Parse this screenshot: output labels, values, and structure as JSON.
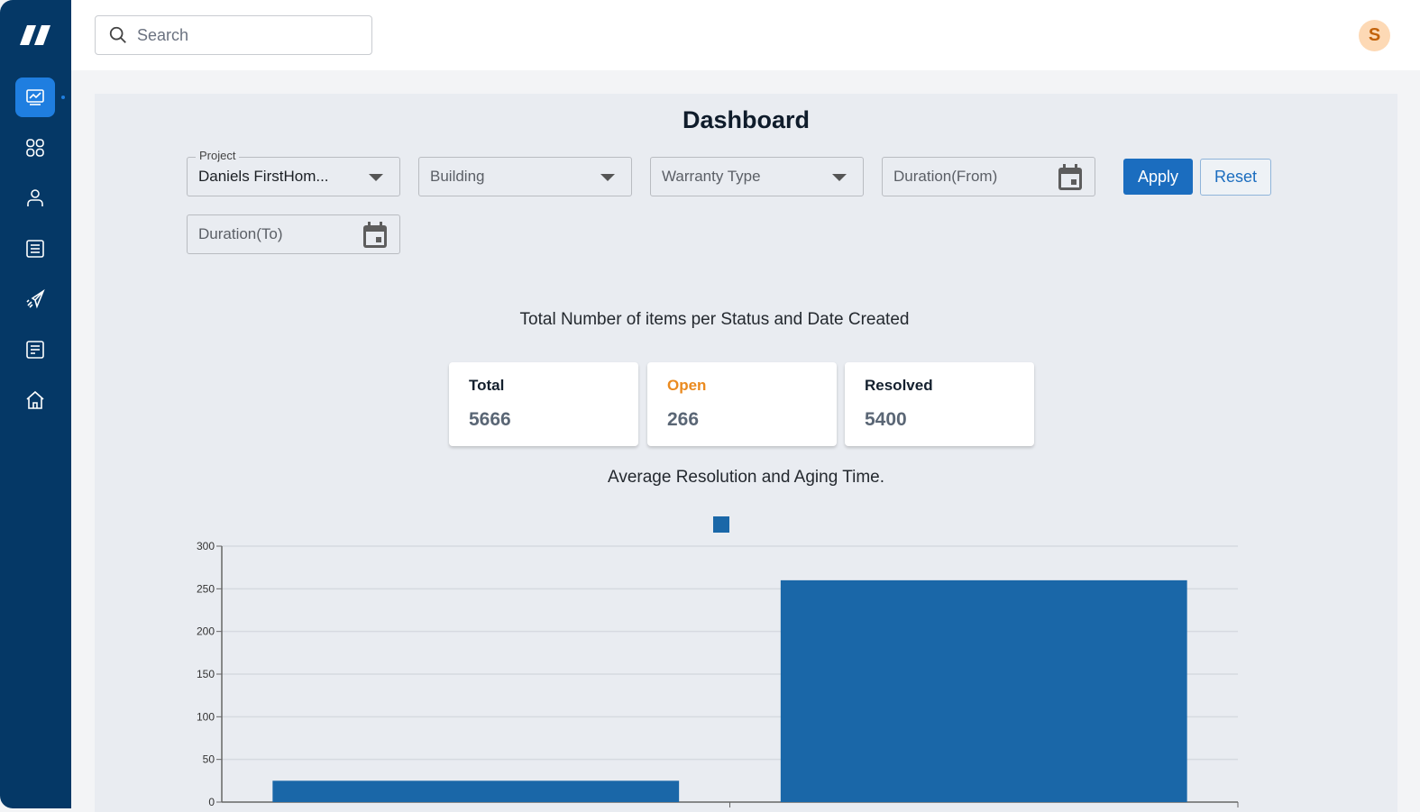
{
  "sidebar": {
    "logo": "brand-logo",
    "items": [
      {
        "name": "dashboard",
        "icon": "chart-monitor-icon",
        "active": true
      },
      {
        "name": "apps",
        "icon": "grid-icon",
        "active": false
      },
      {
        "name": "users",
        "icon": "user-icon",
        "active": false
      },
      {
        "name": "list",
        "icon": "list-icon",
        "active": false
      },
      {
        "name": "send",
        "icon": "paper-plane-icon",
        "active": false
      },
      {
        "name": "documents",
        "icon": "document-icon",
        "active": false
      },
      {
        "name": "home",
        "icon": "home-icon",
        "active": false
      }
    ]
  },
  "header": {
    "search": {
      "placeholder": "Search",
      "value": ""
    },
    "avatar_initial": "S"
  },
  "main": {
    "title": "Dashboard",
    "filters": {
      "project": {
        "label": "Project",
        "value": "Daniels FirstHom..."
      },
      "building": {
        "placeholder": "Building"
      },
      "warranty_type": {
        "placeholder": "Warranty Type"
      },
      "duration_from": {
        "placeholder": "Duration(From)"
      },
      "duration_to": {
        "placeholder": "Duration(To)"
      },
      "apply_label": "Apply",
      "reset_label": "Reset"
    },
    "status_section_title": "Total Number of items per Status and Date Created",
    "stats": [
      {
        "label": "Total",
        "value": "5666"
      },
      {
        "label": "Open",
        "value": "266"
      },
      {
        "label": "Resolved",
        "value": "5400"
      }
    ],
    "colors": {
      "accent": "#1b6dbf",
      "open": "#ea8a1f",
      "bar": "#1a67a8"
    }
  },
  "chart_data": {
    "type": "bar",
    "title": "Average Resolution and Aging Time.",
    "categories": [
      "",
      ""
    ],
    "series": [
      {
        "name": "",
        "values": [
          25,
          260
        ]
      }
    ],
    "xlabel": "",
    "ylabel": "",
    "ylim": [
      0,
      300
    ],
    "yticks": [
      0,
      50,
      100,
      150,
      200,
      250,
      300
    ],
    "grid": true,
    "legend": "top-center"
  }
}
